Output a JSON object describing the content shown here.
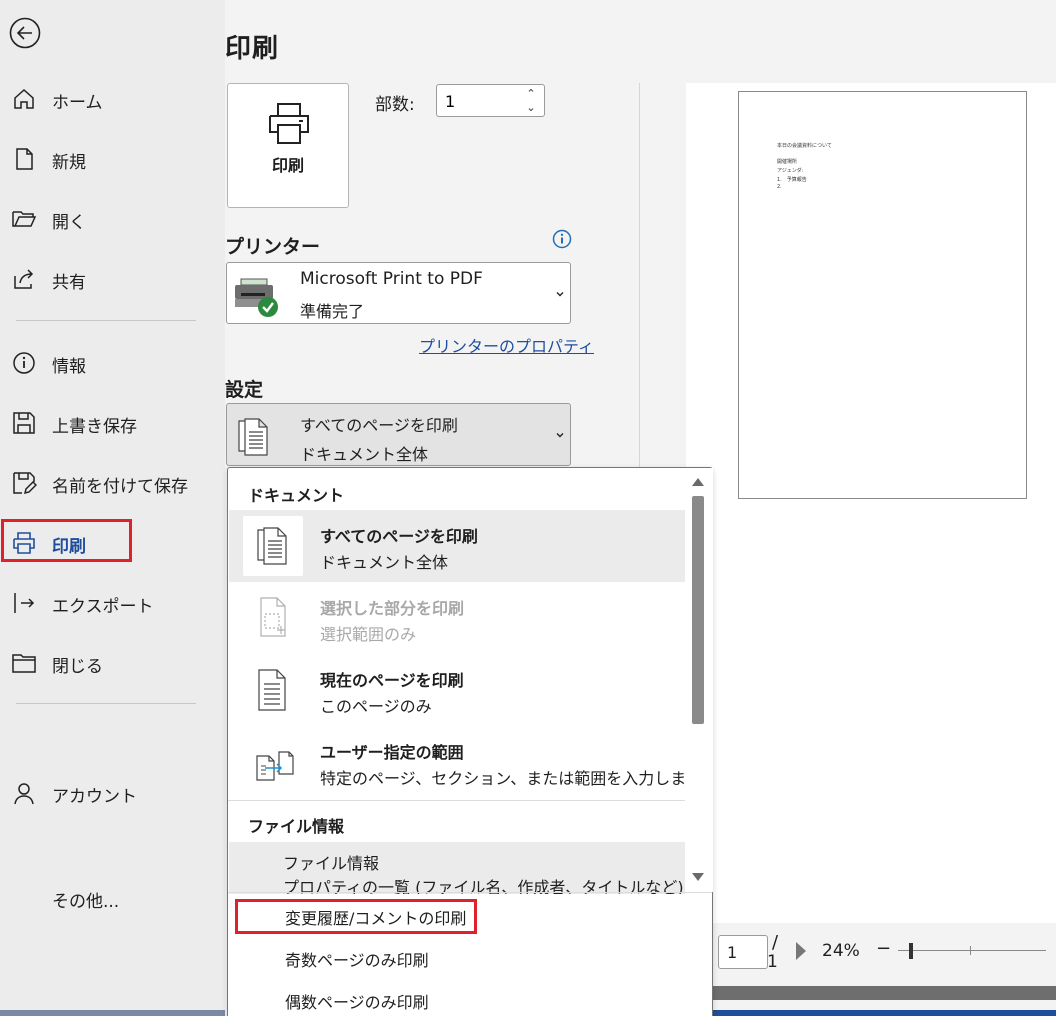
{
  "sidebar": {
    "items": [
      {
        "label": "ホーム",
        "icon": "home-icon"
      },
      {
        "label": "新規",
        "icon": "new-document-icon"
      },
      {
        "label": "開く",
        "icon": "open-folder-icon"
      },
      {
        "label": "共有",
        "icon": "share-icon"
      },
      {
        "label": "情報",
        "icon": "info-icon"
      },
      {
        "label": "上書き保存",
        "icon": "save-icon"
      },
      {
        "label": "名前を付けて保存",
        "icon": "save-as-icon"
      },
      {
        "label": "印刷",
        "icon": "printer-icon",
        "active": true
      },
      {
        "label": "エクスポート",
        "icon": "export-icon"
      },
      {
        "label": "閉じる",
        "icon": "close-folder-icon"
      },
      {
        "label": "アカウント",
        "icon": "account-icon"
      },
      {
        "label": "その他..."
      }
    ]
  },
  "print": {
    "title": "印刷",
    "print_button_label": "印刷",
    "copies_label": "部数:",
    "copies_value": "1"
  },
  "printer": {
    "section_title": "プリンター",
    "name": "Microsoft Print to PDF",
    "status": "準備完了",
    "properties_link": "プリンターのプロパティ"
  },
  "settings": {
    "section_title": "設定",
    "selected_line1": "すべてのページを印刷",
    "selected_line2": "ドキュメント全体"
  },
  "dropdown": {
    "section_document": "ドキュメント",
    "items": [
      {
        "title": "すべてのページを印刷",
        "subtitle": "ドキュメント全体",
        "selected": true
      },
      {
        "title": "選択した部分を印刷",
        "subtitle": "選択範囲のみ",
        "disabled": true
      },
      {
        "title": "現在のページを印刷",
        "subtitle": "このページのみ"
      },
      {
        "title": "ユーザー指定の範囲",
        "subtitle": "特定のページ、セクション、または範囲を入力します"
      }
    ],
    "section_file_info": "ファイル情報",
    "file_info_title": "ファイル情報",
    "file_info_subtitle": "プロパティの一覧 (ファイル名、作成者、タイトルなど)",
    "options": [
      "変更履歴/コメントの印刷",
      "奇数ページのみ印刷",
      "偶数ページのみ印刷"
    ]
  },
  "preview": {
    "page_lines": [
      "本日の会議資料について",
      "開催場所",
      "アジェンダ:",
      "1.　予算報告",
      "2."
    ],
    "current_page": "1",
    "slash": "/",
    "total_pages": "1",
    "zoom": "24%",
    "zoom_minus": "−"
  },
  "colors": {
    "accent": "#1f4e9d",
    "highlight": "#e0202a",
    "status_ok": "#2b8a3e"
  }
}
